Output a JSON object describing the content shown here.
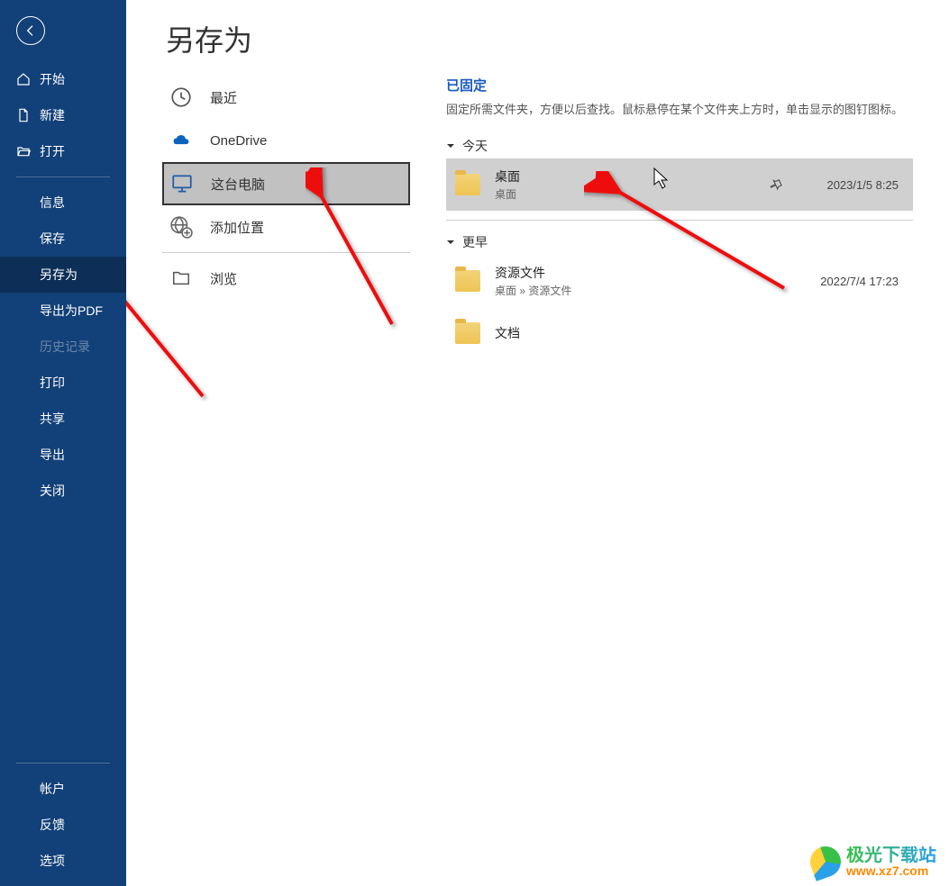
{
  "page_title": "另存为",
  "sidebar": {
    "top": [
      {
        "id": "home",
        "label": "开始",
        "icon": "home"
      },
      {
        "id": "new",
        "label": "新建",
        "icon": "file"
      },
      {
        "id": "open",
        "label": "打开",
        "icon": "folder-open"
      }
    ],
    "mid": [
      {
        "id": "info",
        "label": "信息"
      },
      {
        "id": "save",
        "label": "保存"
      },
      {
        "id": "saveas",
        "label": "另存为",
        "selected": true
      },
      {
        "id": "exportpdf",
        "label": "导出为PDF"
      },
      {
        "id": "history",
        "label": "历史记录",
        "disabled": true
      },
      {
        "id": "print",
        "label": "打印"
      },
      {
        "id": "share",
        "label": "共享"
      },
      {
        "id": "export",
        "label": "导出"
      },
      {
        "id": "close",
        "label": "关闭"
      }
    ],
    "bottom": [
      {
        "id": "account",
        "label": "帐户"
      },
      {
        "id": "feedback",
        "label": "反馈"
      },
      {
        "id": "options",
        "label": "选项"
      }
    ]
  },
  "locations": [
    {
      "id": "recent",
      "label": "最近",
      "icon": "clock"
    },
    {
      "id": "onedrive",
      "label": "OneDrive",
      "icon": "cloud"
    },
    {
      "id": "thispc",
      "label": "这台电脑",
      "icon": "pc",
      "selected": true
    },
    {
      "id": "addplace",
      "label": "添加位置",
      "icon": "globe-plus"
    },
    {
      "id": "browse",
      "label": "浏览",
      "icon": "folder"
    }
  ],
  "recent": {
    "pinned_header": "已固定",
    "pinned_desc": "固定所需文件夹，方便以后查找。鼠标悬停在某个文件夹上方时，单击显示的图钉图标。",
    "groups": [
      {
        "label": "今天",
        "items": [
          {
            "name": "桌面",
            "path": "桌面",
            "date": "2023/1/5 8:25",
            "hovered": true,
            "pin": true
          }
        ]
      },
      {
        "label": "更早",
        "items": [
          {
            "name": "资源文件",
            "path": "桌面 » 资源文件",
            "date": "2022/7/4 17:23"
          },
          {
            "name": "文档",
            "path": "",
            "date": ""
          }
        ]
      }
    ]
  },
  "watermark": {
    "text": "极光下载站",
    "url": "www.xz7.com"
  }
}
